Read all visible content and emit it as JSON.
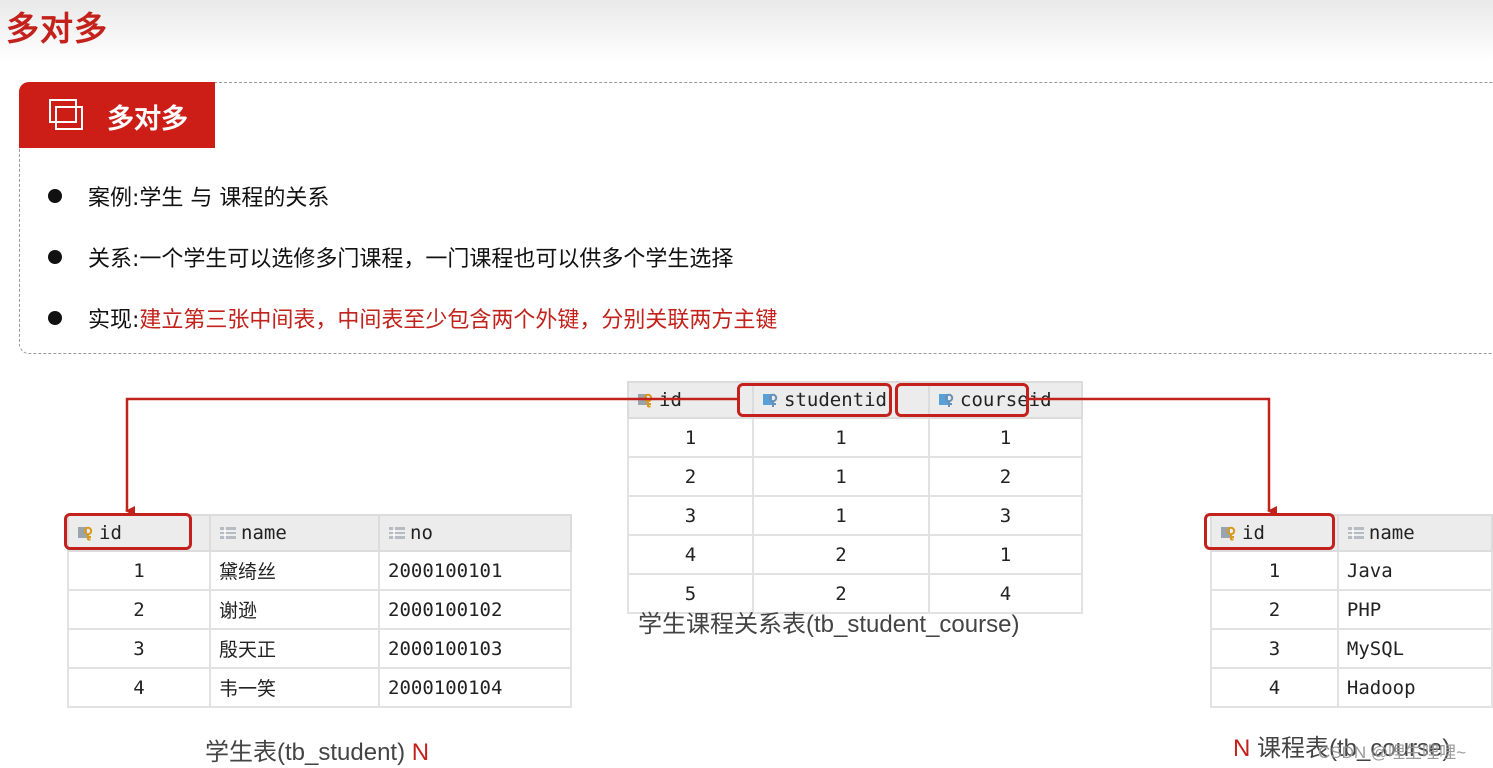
{
  "page_title": "多对多",
  "section": {
    "tab_label": "多对多",
    "bullets": [
      {
        "label": "案例: ",
        "text": "学生 与 课程的关系",
        "highlight": ""
      },
      {
        "label": "关系: ",
        "text": "一个学生可以选修多门课程，一门课程也可以供多个学生选择",
        "highlight": ""
      },
      {
        "label": "实现: ",
        "text": "",
        "highlight": "建立第三张中间表，中间表至少包含两个外键，分别关联两方主键"
      }
    ]
  },
  "student_table": {
    "caption": "学生表(tb_student)",
    "cardinality": "N",
    "columns": [
      "id",
      "name",
      "no"
    ],
    "column_icons": [
      "primary-key-icon",
      "column-icon",
      "column-icon"
    ],
    "rows": [
      [
        "1",
        "黛绮丝",
        "2000100101"
      ],
      [
        "2",
        "谢逊",
        "2000100102"
      ],
      [
        "3",
        "殷天正",
        "2000100103"
      ],
      [
        "4",
        "韦一笑",
        "2000100104"
      ]
    ]
  },
  "link_table": {
    "caption": "学生课程关系表(tb_student_course)",
    "columns": [
      "id",
      "studentid",
      "courseid"
    ],
    "column_icons": [
      "primary-key-icon",
      "foreign-key-icon",
      "foreign-key-icon"
    ],
    "rows": [
      [
        "1",
        "1",
        "1"
      ],
      [
        "2",
        "1",
        "2"
      ],
      [
        "3",
        "1",
        "3"
      ],
      [
        "4",
        "2",
        "1"
      ],
      [
        "5",
        "2",
        "4"
      ]
    ]
  },
  "course_table": {
    "caption": "课程表(tb_course)",
    "cardinality": "N",
    "columns": [
      "id",
      "name"
    ],
    "column_icons": [
      "primary-key-icon",
      "column-icon"
    ],
    "rows": [
      [
        "1",
        "Java"
      ],
      [
        "2",
        "PHP"
      ],
      [
        "3",
        "MySQL"
      ],
      [
        "4",
        "Hadoop"
      ]
    ]
  },
  "watermark": "CSDN @哩生哩哩~",
  "colors": {
    "accent": "#c2221b",
    "tab_bg": "#cc1d16",
    "header_bg": "#ececec"
  }
}
